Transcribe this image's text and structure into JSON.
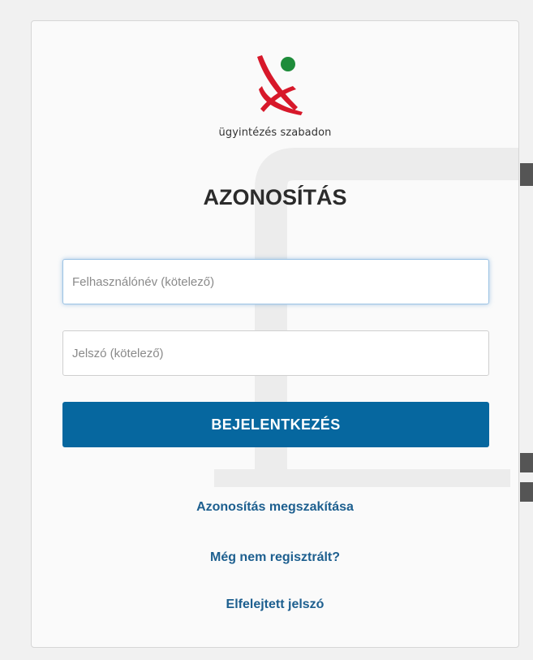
{
  "logo": {
    "text": "ügyintézés szabadon",
    "colors": {
      "red": "#d7182a",
      "green": "#1e8c3a"
    }
  },
  "form": {
    "title": "AZONOSÍTÁS",
    "username_placeholder": "Felhasználónév (kötelező)",
    "username_value": "",
    "password_placeholder": "Jelszó (kötelező)",
    "password_value": "",
    "submit_label": "BEJELENTKEZÉS"
  },
  "links": {
    "cancel": "Azonosítás megszakítása",
    "register": "Még nem regisztrált?",
    "forgot": "Elfelejtett jelszó"
  },
  "colors": {
    "button": "#06679f",
    "link": "#1d5f8f"
  }
}
